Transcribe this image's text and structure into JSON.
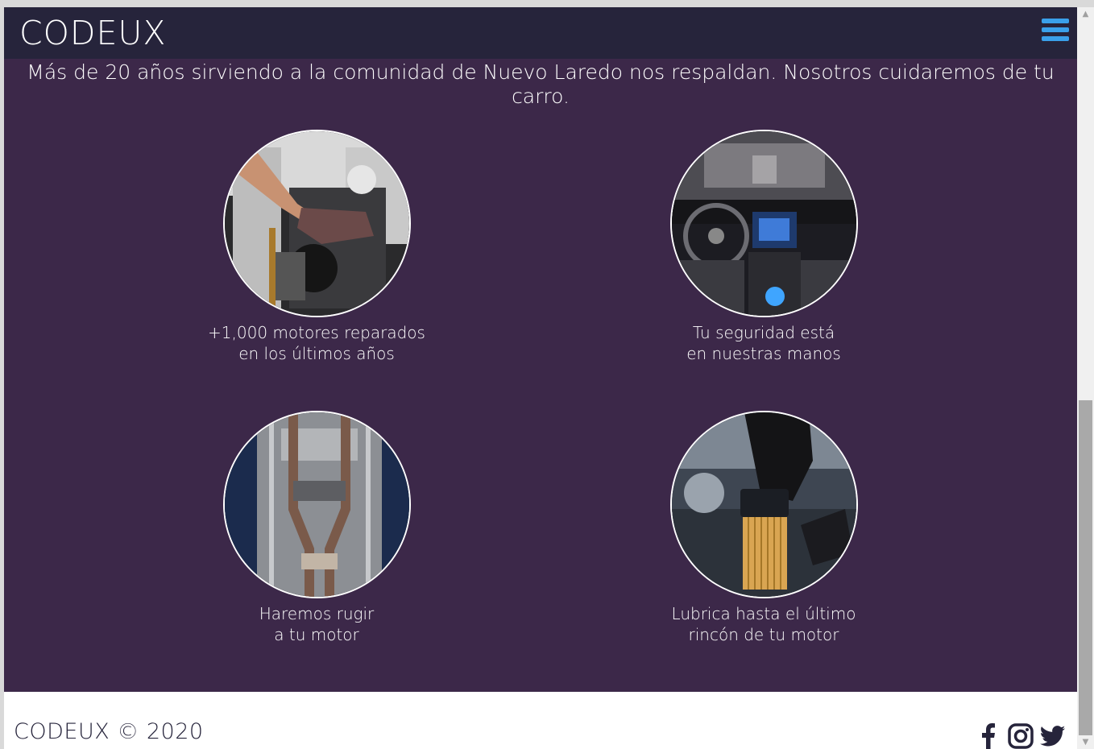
{
  "header": {
    "brand": "CODEUX",
    "menu_icon": "hamburger-icon",
    "accent_color": "#3aa0ea"
  },
  "intro": {
    "text": "Más de 20 años sirviendo a la comunidad de Nuevo Laredo nos respaldan. Nosotros cuidaremos de tu carro."
  },
  "features": [
    {
      "line1": "+1,000 motores reparados",
      "line2": "en los últimos años"
    },
    {
      "line1": "Tu seguridad está",
      "line2": "en nuestras manos"
    },
    {
      "line1": "Haremos rugir",
      "line2": "a tu motor"
    },
    {
      "line1": "Lubrica hasta el último",
      "line2": "rincón de tu motor"
    }
  ],
  "footer": {
    "copyright": "CODEUX © 2020",
    "social": [
      "facebook-icon",
      "instagram-icon",
      "twitter-icon"
    ]
  },
  "colors": {
    "page_bg": "#3c2849",
    "topbar_bg": "#26243b",
    "footer_bg": "#ffffff"
  }
}
